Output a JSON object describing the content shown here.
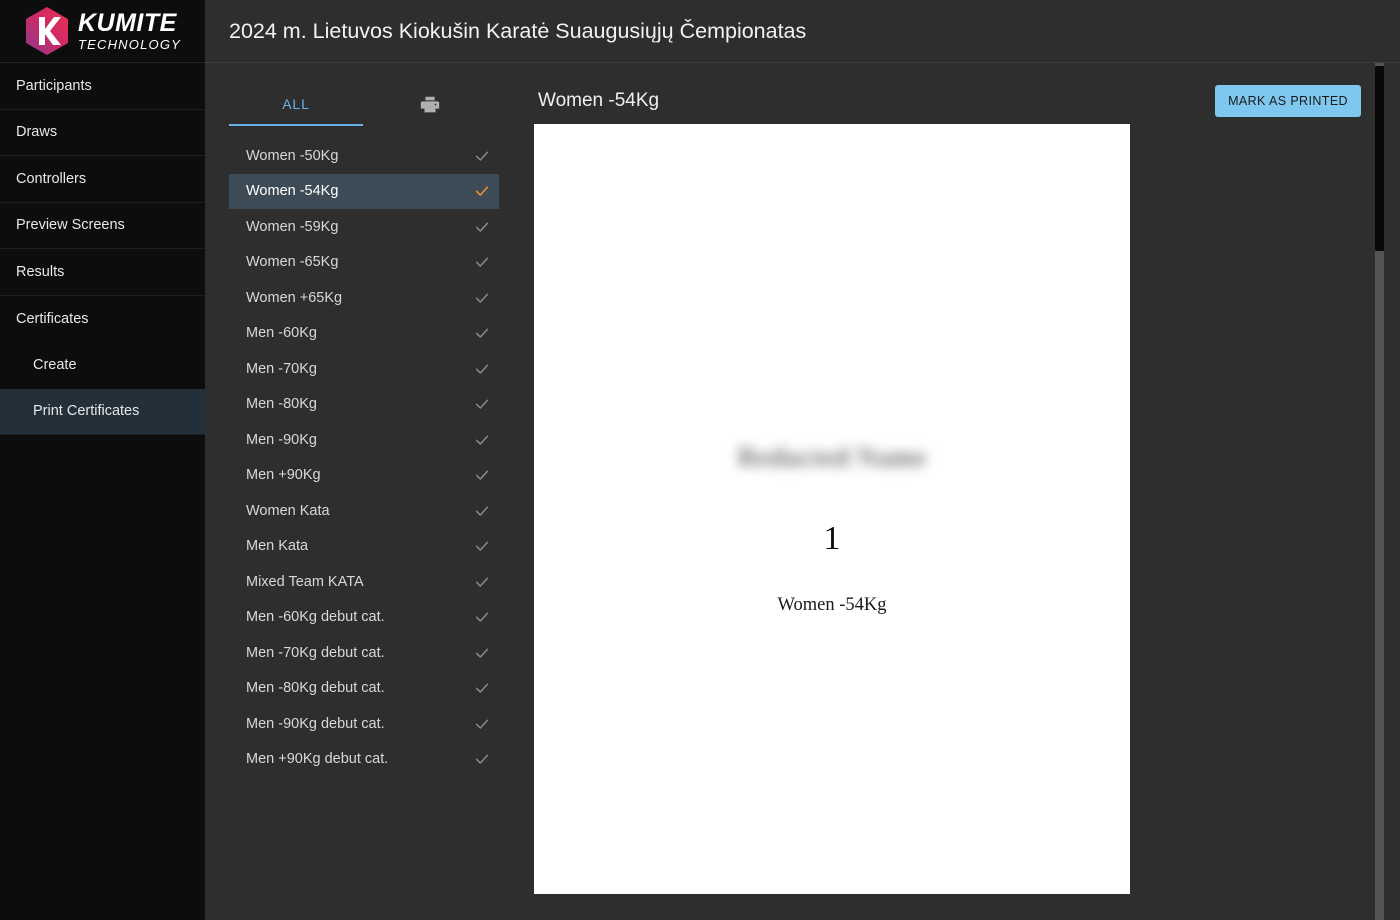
{
  "brand": {
    "name_line1": "KUMITE",
    "name_line2": "TECHNOLOGY",
    "logo_letter": "K",
    "gradient_start": "#8e3a8e",
    "gradient_end": "#e8334f"
  },
  "sidebar": {
    "items": [
      {
        "label": "Participants",
        "active": false,
        "sub": false
      },
      {
        "label": "Draws",
        "active": false,
        "sub": false
      },
      {
        "label": "Controllers",
        "active": false,
        "sub": false
      },
      {
        "label": "Preview Screens",
        "active": false,
        "sub": false
      },
      {
        "label": "Results",
        "active": false,
        "sub": false
      },
      {
        "label": "Certificates",
        "active": false,
        "sub": false
      },
      {
        "label": "Create",
        "active": false,
        "sub": true
      },
      {
        "label": "Print Certificates",
        "active": true,
        "sub": true
      }
    ]
  },
  "header": {
    "title": "2024 m. Lietuvos Kiokušin Karatė Suaugusiųjų Čempionatas"
  },
  "list_panel": {
    "tabs": [
      {
        "label": "ALL",
        "active": true
      },
      {
        "icon": "printer-icon",
        "active": false
      }
    ],
    "active_tab_color": "#66b2e8",
    "selected_check_color": "#e8912e",
    "check_color": "#8c8c8c",
    "categories": [
      {
        "label": "Women -50Kg",
        "checked": true,
        "selected": false
      },
      {
        "label": "Women -54Kg",
        "checked": true,
        "selected": true
      },
      {
        "label": "Women -59Kg",
        "checked": true,
        "selected": false
      },
      {
        "label": "Women -65Kg",
        "checked": true,
        "selected": false
      },
      {
        "label": "Women +65Kg",
        "checked": true,
        "selected": false
      },
      {
        "label": "Men -60Kg",
        "checked": true,
        "selected": false
      },
      {
        "label": "Men -70Kg",
        "checked": true,
        "selected": false
      },
      {
        "label": "Men -80Kg",
        "checked": true,
        "selected": false
      },
      {
        "label": "Men -90Kg",
        "checked": true,
        "selected": false
      },
      {
        "label": "Men +90Kg",
        "checked": true,
        "selected": false
      },
      {
        "label": "Women Kata",
        "checked": true,
        "selected": false
      },
      {
        "label": "Men Kata",
        "checked": true,
        "selected": false
      },
      {
        "label": "Mixed Team KATA",
        "checked": true,
        "selected": false
      },
      {
        "label": "Men -60Kg debut cat.",
        "checked": true,
        "selected": false
      },
      {
        "label": "Men -70Kg debut cat.",
        "checked": true,
        "selected": false
      },
      {
        "label": "Men -80Kg debut cat.",
        "checked": true,
        "selected": false
      },
      {
        "label": "Men -90Kg debut cat.",
        "checked": true,
        "selected": false
      },
      {
        "label": "Men +90Kg debut cat.",
        "checked": true,
        "selected": false
      }
    ]
  },
  "preview": {
    "title": "Women -54Kg",
    "mark_printed_label": "MARK AS PRINTED",
    "mark_printed_color": "#7ec8f0",
    "certificate": {
      "recipient_name": "Redacted Name",
      "place": "1",
      "category": "Women -54Kg"
    }
  }
}
